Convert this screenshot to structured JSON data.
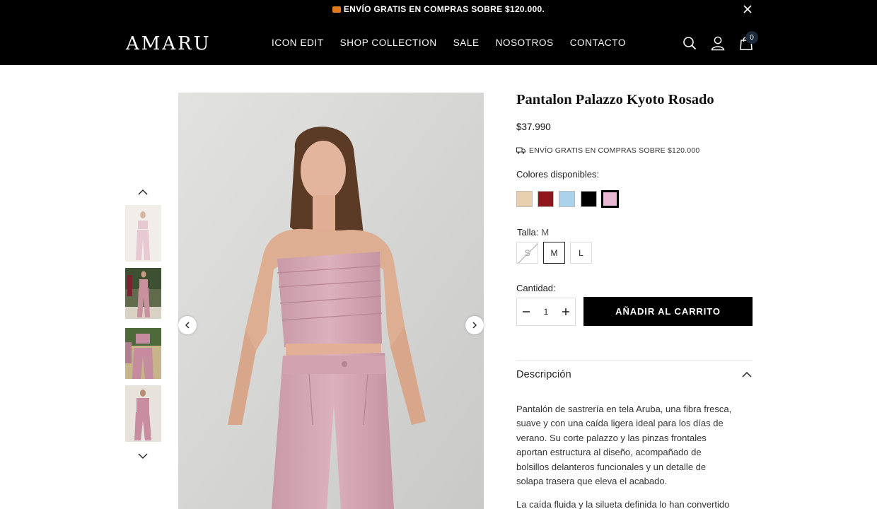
{
  "announcement": {
    "text": "ENVÍO GRATIS EN COMPRAS SOBRE $120.000.",
    "icon": "truck-icon",
    "close_icon": "close-icon"
  },
  "header": {
    "logo": "AMARU",
    "nav": [
      "ICON EDIT",
      "SHOP COLLECTION",
      "SALE",
      "NOSOTROS",
      "CONTACTO"
    ],
    "icons": [
      "search-icon",
      "user-icon",
      "cart-icon"
    ],
    "cart_count": "0"
  },
  "gallery": {
    "thumbnails": 4,
    "prev_icon": "chevron-up-icon",
    "next_icon": "chevron-down-icon",
    "image_prev_icon": "chevron-left-icon",
    "image_next_icon": "chevron-right-icon"
  },
  "product": {
    "title": "Pantalon Palazzo Kyoto Rosado",
    "price": "$37.990",
    "shipping_note": "ENVÍO GRATIS EN COMPRAS SOBRE $120.000",
    "colors_label": "Colores disponibles:",
    "colors": [
      "#e8d0ae",
      "#8f161c",
      "#a9d1ea",
      "#000000",
      "#e8b8d2"
    ],
    "selected_color_index": 4,
    "size_label": "Talla:",
    "size_value": "M",
    "sizes": [
      {
        "label": "S",
        "available": false
      },
      {
        "label": "M",
        "available": true,
        "selected": true
      },
      {
        "label": "L",
        "available": true
      }
    ],
    "quantity_label": "Cantidad:",
    "quantity": "1",
    "add_to_cart": "AÑADIR AL CARRITO"
  },
  "description": {
    "heading": "Descripción",
    "paragraph1_lines": [
      "Pantalón de sastrería en tela Aruba, una fibra fresca,",
      "suave y con una caída ligera ideal para los días de",
      "verano. Su corte palazzo y las pinzas frontales",
      "aportan estructura al diseño, acompañado de",
      "bolsillos delanteros funcionales y un detalle de",
      "solapa trasera que eleva el acabado."
    ],
    "paragraph2_lines": [
      "La caída fluida y la silueta definida lo han convertido"
    ]
  },
  "colors": {
    "header_bg": "#000000",
    "product_pink": "#d9a8b8",
    "button_bg": "#000000"
  }
}
